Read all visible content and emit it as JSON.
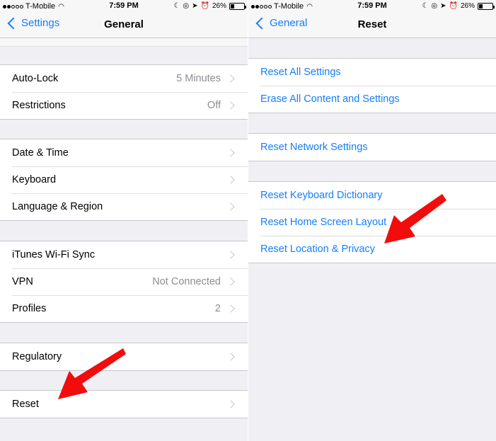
{
  "status_bar": {
    "carrier": "T-Mobile",
    "time": "7:59 PM",
    "battery": "26%",
    "battery_level": 0.26
  },
  "left": {
    "back_label": "Settings",
    "title": "General",
    "groups": [
      [
        {
          "label": "Auto-Lock",
          "value": "5 Minutes"
        },
        {
          "label": "Restrictions",
          "value": "Off"
        }
      ],
      [
        {
          "label": "Date & Time",
          "value": ""
        },
        {
          "label": "Keyboard",
          "value": ""
        },
        {
          "label": "Language & Region",
          "value": ""
        }
      ],
      [
        {
          "label": "iTunes Wi-Fi Sync",
          "value": ""
        },
        {
          "label": "VPN",
          "value": "Not Connected"
        },
        {
          "label": "Profiles",
          "value": "2"
        }
      ],
      [
        {
          "label": "Regulatory",
          "value": ""
        }
      ],
      [
        {
          "label": "Reset",
          "value": ""
        }
      ]
    ]
  },
  "right": {
    "back_label": "General",
    "title": "Reset",
    "groups": [
      [
        {
          "label": "Reset All Settings"
        },
        {
          "label": "Erase All Content and Settings"
        }
      ],
      [
        {
          "label": "Reset Network Settings"
        }
      ],
      [
        {
          "label": "Reset Keyboard Dictionary"
        },
        {
          "label": "Reset Home Screen Layout"
        },
        {
          "label": "Reset Location & Privacy"
        }
      ]
    ]
  },
  "colors": {
    "accent": "#157efb",
    "arrow": "#f20c0c"
  },
  "icons": [
    "signal-dots-icon",
    "wifi-icon",
    "moon-icon",
    "lock-rotation-icon",
    "location-icon",
    "alarm-icon",
    "battery-icon",
    "back-chevron-icon",
    "chevron-right-icon",
    "red-arrow-icon"
  ]
}
